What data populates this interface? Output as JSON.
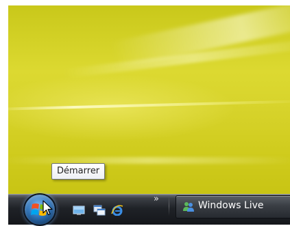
{
  "desktop": {
    "wallpaper_color": "#d6d32a"
  },
  "tooltip": {
    "text": "Démarrer"
  },
  "taskbar": {
    "start_button_icon": "windows-logo-icon",
    "quick_launch": [
      {
        "icon": "show-desktop-icon"
      },
      {
        "icon": "switch-windows-icon"
      },
      {
        "icon": "internet-explorer-icon"
      }
    ],
    "overflow_chevron": "»",
    "task_buttons": [
      {
        "label": "Windows Live",
        "icon": "windows-live-messenger-icon"
      }
    ]
  },
  "colors": {
    "taskbar": "#1f2227",
    "start_orb": "#2f73b8",
    "tooltip_border": "#6f7580"
  }
}
